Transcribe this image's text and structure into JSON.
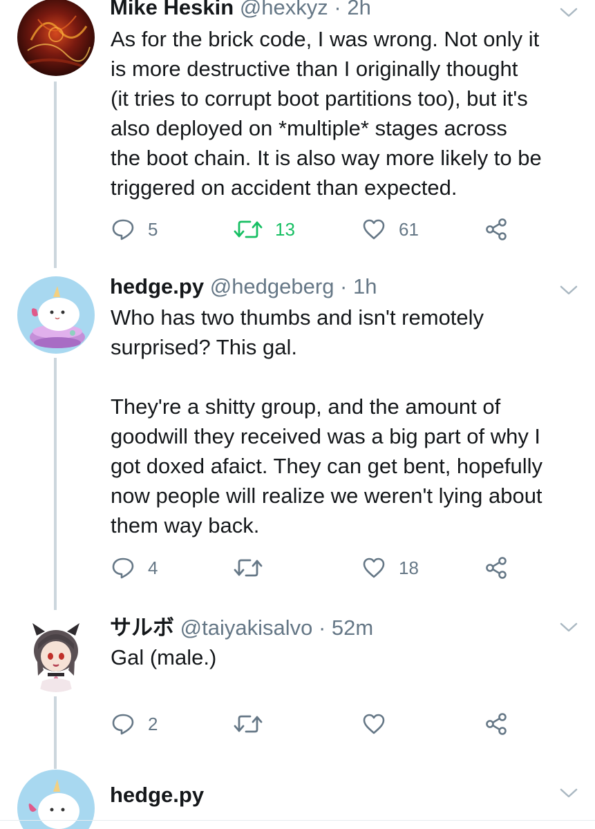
{
  "tweets": [
    {
      "name": "Mike Heskin",
      "handle": "@hexkyz",
      "time": "2h",
      "text": "As for the brick code, I was wrong. Not only it\nis more destructive than I originally thought\n(it tries to corrupt boot partitions too), but it's\nalso deployed on *multiple* stages across\nthe boot chain. It is also way more likely to be\ntriggered on accident than expected.",
      "replies": "5",
      "retweets": "13",
      "likes": "61",
      "retweeted": true,
      "avatar_style": "red-abstract"
    },
    {
      "name": "hedge.py",
      "handle": "@hedgeberg",
      "time": "1h",
      "text": "Who has two thumbs and isn't remotely\nsurprised? This gal.\n\nThey're a shitty group, and the amount of\ngoodwill they received was a big part of why I\ngot doxed afaict. They can get bent, hopefully\nnow people will realize we weren't lying about\nthem way back.",
      "replies": "4",
      "retweets": "",
      "likes": "18",
      "retweeted": false,
      "avatar_style": "white-creature-blue-bg"
    },
    {
      "name": "サルボ",
      "handle": "@taiyakisalvo",
      "time": "52m",
      "text": "Gal (male.)",
      "replies": "2",
      "retweets": "",
      "likes": "",
      "retweeted": false,
      "avatar_style": "anime-catgirl"
    },
    {
      "name": "hedge.py",
      "avatar_style": "white-creature-blue-bg"
    }
  ],
  "colors": {
    "text": "#14171a",
    "secondary": "#657786",
    "retweet_active": "#17bf63",
    "thread_line": "#ccd6dd"
  },
  "icons": {
    "reply": "reply-icon",
    "retweet": "retweet-icon",
    "like": "heart-icon",
    "share": "share-icon",
    "caret": "chevron-down-icon"
  }
}
